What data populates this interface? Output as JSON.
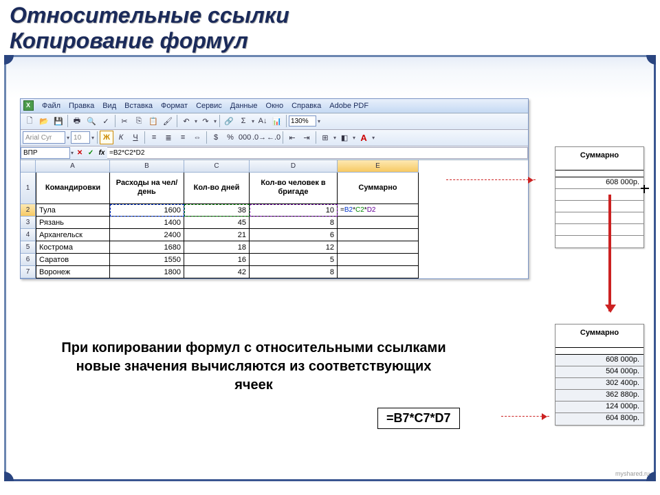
{
  "title_line1": "Относительные ссылки",
  "title_line2": "Копирование формул",
  "menu": {
    "file": "Файл",
    "edit": "Правка",
    "view": "Вид",
    "insert": "Вставка",
    "format": "Формат",
    "service": "Сервис",
    "data": "Данные",
    "window": "Окно",
    "help": "Справка",
    "adobe": "Adobe PDF"
  },
  "toolbar": {
    "font": "Arial Cyr",
    "size": "10",
    "bold": "Ж",
    "italic": "К",
    "underline": "Ч",
    "zoom": "130%",
    "sigma": "Σ",
    "A_color": "A"
  },
  "formula_bar": {
    "name_box": "ВПР",
    "formula": "=B2*C2*D2",
    "fx": "fx"
  },
  "columns": [
    "A",
    "B",
    "C",
    "D",
    "E"
  ],
  "headers": {
    "A": "Командировки",
    "B": "Расходы на чел/день",
    "C": "Кол-во дней",
    "D": "Кол-во человек в бригаде",
    "E": "Суммарно"
  },
  "rows": [
    {
      "n": "2",
      "A": "Тула",
      "B": "1600",
      "C": "38",
      "D": "10",
      "E": "=B2*C2*D2"
    },
    {
      "n": "3",
      "A": "Рязань",
      "B": "1400",
      "C": "45",
      "D": "8",
      "E": ""
    },
    {
      "n": "4",
      "A": "Архангельск",
      "B": "2400",
      "C": "21",
      "D": "6",
      "E": ""
    },
    {
      "n": "5",
      "A": "Кострома",
      "B": "1680",
      "C": "18",
      "D": "12",
      "E": ""
    },
    {
      "n": "6",
      "A": "Саратов",
      "B": "1550",
      "C": "16",
      "D": "5",
      "E": ""
    },
    {
      "n": "7",
      "A": "Воронеж",
      "B": "1800",
      "C": "42",
      "D": "8",
      "E": ""
    }
  ],
  "result_top": {
    "header": "Суммарно",
    "value": "608 000р."
  },
  "result_bottom": {
    "header": "Суммарно",
    "values": [
      "608 000р.",
      "504 000р.",
      "302 400р.",
      "362 880р.",
      "124 000р.",
      "604 800р."
    ]
  },
  "caption": "При копировании формул с относительными ссылками новые значения вычисляются из соответствующих ячеек",
  "formula_callout": "=B7*C7*D7",
  "watermark": "myshared.ru",
  "row1_label": "1"
}
